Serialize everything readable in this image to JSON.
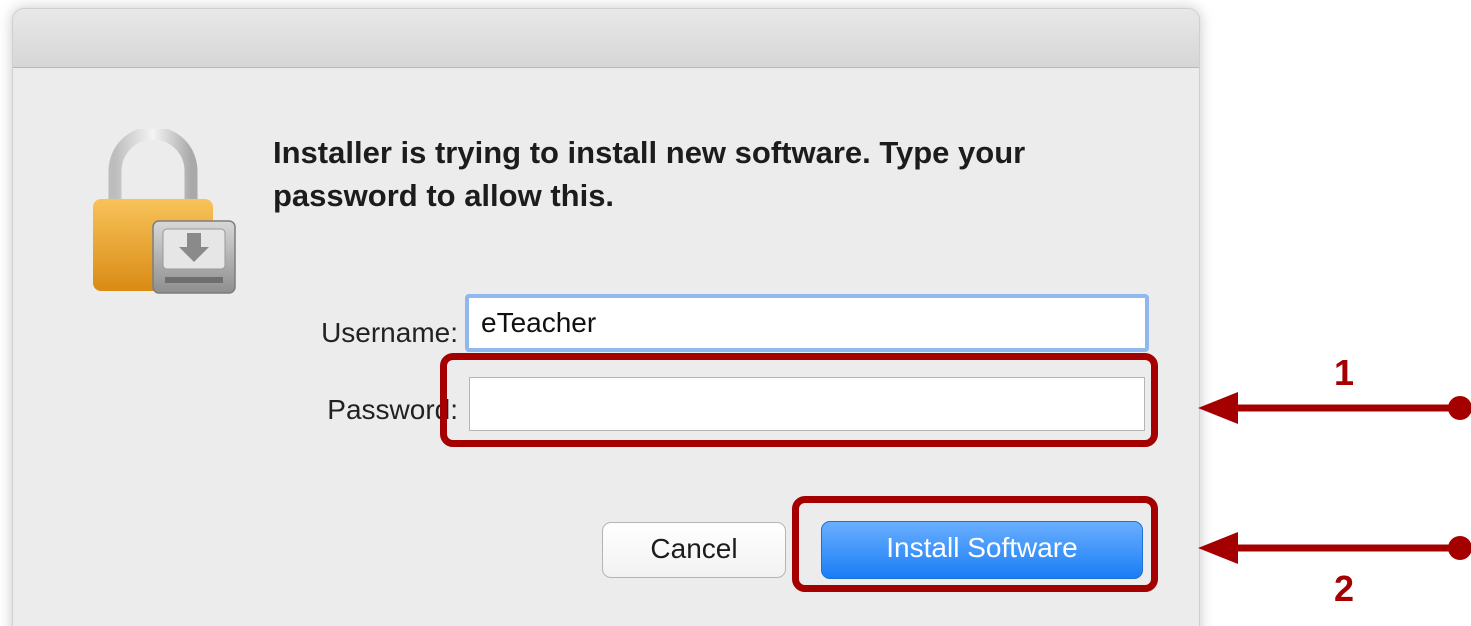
{
  "dialog": {
    "message": "Installer is trying to install new software. Type your password to allow this.",
    "icon": "lock-with-installer-drive-icon"
  },
  "form": {
    "username_label": "Username:",
    "username_value": "eTeacher",
    "password_label": "Password:",
    "password_value": ""
  },
  "buttons": {
    "cancel_label": "Cancel",
    "install_label": "Install Software"
  },
  "annotations": {
    "step1_label": "1",
    "step2_label": "2",
    "color": "#a40000"
  },
  "colors": {
    "accent_blue": "#1a7df5",
    "focus_ring": "#8fb8ee",
    "dialog_bg": "#ececec"
  }
}
